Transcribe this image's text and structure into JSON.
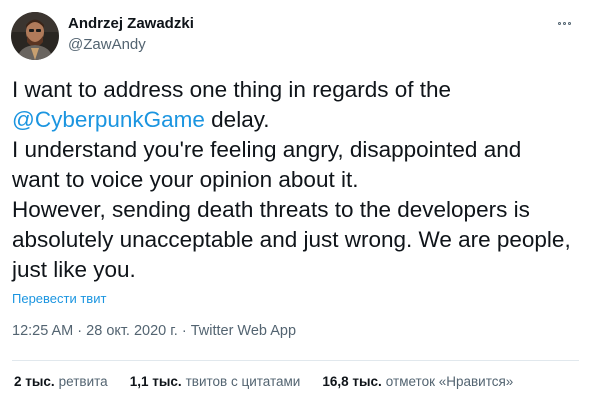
{
  "author": {
    "name": "Andrzej Zawadzki",
    "handle": "@ZawAndy"
  },
  "menu": {
    "icon": "more-options-icon"
  },
  "tweet": {
    "line1": "I want to address one thing in regards of the",
    "mention": "@CyberpunkGame",
    "line2_rest": " delay.",
    "line3": "I understand you're feeling angry, disappointed and",
    "line4": "want to voice your opinion about it.",
    "line5": "However, sending death threats to the developers is",
    "line6": "absolutely unacceptable and just wrong. We are people,",
    "line7": "just like you."
  },
  "translate_label": "Перевести твит",
  "meta": {
    "time": "12:25 AM",
    "sep1": " · ",
    "date": "28 окт. 2020 г.",
    "sep2": " · ",
    "source": "Twitter Web App"
  },
  "stats": {
    "retweets_count": "2 тыс.",
    "retweets_label": "ретвита",
    "quotes_count": "1,1 тыс.",
    "quotes_label": "твитов с цитатами",
    "likes_count": "16,8 тыс.",
    "likes_label": "отметок «Нравится»"
  },
  "colors": {
    "link": "#1b95e0",
    "text": "#0f1419",
    "muted": "#536471",
    "divider": "#e1e8ed"
  }
}
